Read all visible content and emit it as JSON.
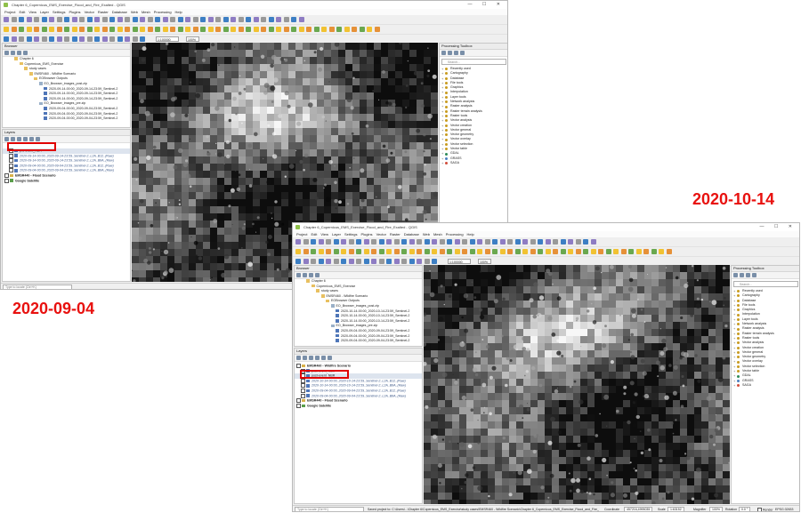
{
  "back_window": {
    "title": "Chapter 6_Copernicus_EMS_Exercise_Flood_and_Fire_Exalted - QGIS",
    "window_controls": "— ☐ ✕",
    "menu": [
      "Project",
      "Edit",
      "View",
      "Layer",
      "Settings",
      "Plugins",
      "Vector",
      "Raster",
      "Database",
      "Web",
      "Mesh",
      "Processing",
      "Help"
    ],
    "toolbar": {
      "scale_value": "1:100000",
      "zoom_value": "100%",
      "rotation_value": "0.0°",
      "render_value": "Render"
    },
    "browser": {
      "header": "Browser",
      "items": [
        {
          "label": "Chapter 6",
          "depth": 2,
          "kind": "folder"
        },
        {
          "label": "Copernicus_EMS_Exercise",
          "depth": 3,
          "kind": "folder"
        },
        {
          "label": "study cases",
          "depth": 4,
          "kind": "folder"
        },
        {
          "label": "EMSR460 - Wildfire Scenario",
          "depth": 5,
          "kind": "folder"
        },
        {
          "label": "EOBrowser Outputs",
          "depth": 6,
          "kind": "folder"
        },
        {
          "label": "EO_Browser_images_post.zip",
          "depth": 7,
          "kind": "zip"
        },
        {
          "label": "2020-09-14-00:00_2020-09-14-23:59_Sentinel-2",
          "depth": 8,
          "kind": "raster"
        },
        {
          "label": "2020-09-14-00:00_2020-09-14-23:59_Sentinel-2",
          "depth": 8,
          "kind": "raster"
        },
        {
          "label": "2020-09-14-00:00_2020-09-14-23:59_Sentinel-2",
          "depth": 8,
          "kind": "raster"
        },
        {
          "label": "EO_Browser_images_pre.zip",
          "depth": 7,
          "kind": "zip"
        },
        {
          "label": "2020-09-04-00:00_2020-09-04-23:59_Sentinel-2",
          "depth": 8,
          "kind": "raster"
        },
        {
          "label": "2020-09-04-00:00_2020-09-04-23:59_Sentinel-2",
          "depth": 8,
          "kind": "raster"
        },
        {
          "label": "2020-09-04-00:00_2020-09-04-23:59_Sentinel-2",
          "depth": 8,
          "kind": "raster"
        }
      ]
    },
    "layers": {
      "header": "Layers",
      "items": [
        {
          "label": "pre-event_NBR",
          "depth": 1,
          "kind": "raster",
          "highlight": true
        },
        {
          "label": "2020-09-14-00:00_2020-09-14-23:59_Sentinel-2_L2A_B12_(Raw)",
          "depth": 1,
          "kind": "raster",
          "muted": true
        },
        {
          "label": "2020-09-14-00:00_2020-09-14-23:59_Sentinel-2_L2A_B8A_(Raw)",
          "depth": 1,
          "kind": "raster",
          "muted": true
        },
        {
          "label": "2020-09-04-00:00_2020-09-04-23:59_Sentinel-2_L2A_B12_(Raw)",
          "depth": 1,
          "kind": "raster",
          "muted": true
        },
        {
          "label": "2020-09-04-00:00_2020-09-04-23:59_Sentinel-2_L2A_B8A_(Raw)",
          "depth": 1,
          "kind": "raster",
          "muted": true
        },
        {
          "label": "EMSR440 - Flood Scenario",
          "depth": 0,
          "kind": "group"
        },
        {
          "label": "Google Satellite",
          "depth": 0,
          "kind": "web"
        }
      ]
    },
    "processing": {
      "header": "Processing Toolbox",
      "search_placeholder": "Search...",
      "items": [
        "Recently used",
        "Cartography",
        "Database",
        "File tools",
        "Graphics",
        "Interpolation",
        "Layer tools",
        "Network analysis",
        "Raster analysis",
        "Raster terrain analysis",
        "Raster tools",
        "Vector analysis",
        "Vector creation",
        "Vector general",
        "Vector geometry",
        "Vector overlay",
        "Vector selection",
        "Vector table",
        "GDAL",
        "GRASS",
        "SAGA"
      ]
    },
    "status": {
      "locator_placeholder": "Type to locate (Ctrl+K)"
    }
  },
  "front_window": {
    "title": "Chapter 6_Copernicus_EMS_Exercise_Flood_and_Fire_Exalted - QGIS",
    "window_controls": "— ☐ ✕",
    "menu": [
      "Project",
      "Edit",
      "View",
      "Layer",
      "Settings",
      "Plugins",
      "Vector",
      "Raster",
      "Database",
      "Web",
      "Mesh",
      "Processing",
      "Help"
    ],
    "toolbar": {
      "scale_value": "1:100000",
      "zoom_value": "100%",
      "rotation_value": "0.0°",
      "render_value": "Render"
    },
    "browser": {
      "header": "Browser",
      "items": [
        {
          "label": "Chapter 6",
          "depth": 2,
          "kind": "folder"
        },
        {
          "label": "Copernicus_EMS_Exercise",
          "depth": 3,
          "kind": "folder"
        },
        {
          "label": "study cases",
          "depth": 4,
          "kind": "folder"
        },
        {
          "label": "EMSR460 - Wildfire Scenario",
          "depth": 5,
          "kind": "folder"
        },
        {
          "label": "EOBrowser Outputs",
          "depth": 6,
          "kind": "folder"
        },
        {
          "label": "EO_Browser_images_post.zip",
          "depth": 7,
          "kind": "zip"
        },
        {
          "label": "2020-10-14-00:00_2020-10-14-23:59_Sentinel-2",
          "depth": 8,
          "kind": "raster"
        },
        {
          "label": "2020-10-14-00:00_2020-10-14-23:59_Sentinel-2",
          "depth": 8,
          "kind": "raster"
        },
        {
          "label": "2020-10-14-00:00_2020-10-14-23:59_Sentinel-2",
          "depth": 8,
          "kind": "raster"
        },
        {
          "label": "EO_Browser_images_pre.zip",
          "depth": 7,
          "kind": "zip"
        },
        {
          "label": "2020-09-04-00:00_2020-09-04-23:59_Sentinel-2",
          "depth": 8,
          "kind": "raster"
        },
        {
          "label": "2020-09-04-00:00_2020-09-04-23:59_Sentinel-2",
          "depth": 8,
          "kind": "raster"
        },
        {
          "label": "2020-09-04-00:00_2020-09-04-23:59_Sentinel-2",
          "depth": 8,
          "kind": "raster"
        }
      ]
    },
    "layers": {
      "header": "Layers",
      "items": [
        {
          "label": "EMSR460 - Wildfire Scenario",
          "depth": 0,
          "kind": "group"
        },
        {
          "label": "post-event_NBR",
          "depth": 1,
          "kind": "raster"
        },
        {
          "label": "post-event_NBR",
          "depth": 1,
          "kind": "raster",
          "highlight": true
        },
        {
          "label": "2020-10-14-00:00_2020-10-14-23:59_Sentinel-2_L2A_B12_(Raw)",
          "depth": 1,
          "kind": "raster",
          "muted": true
        },
        {
          "label": "2020-10-14-00:00_2020-10-14-23:59_Sentinel-2_L2A_B8A_(Raw)",
          "depth": 1,
          "kind": "raster",
          "muted": true
        },
        {
          "label": "2020-09-04-00:00_2020-09-04-23:59_Sentinel-2_L2A_B12_(Raw)",
          "depth": 1,
          "kind": "raster",
          "muted": true
        },
        {
          "label": "2020-09-04-00:00_2020-09-04-23:59_Sentinel-2_L2A_B8A_(Raw)",
          "depth": 1,
          "kind": "raster",
          "muted": true
        },
        {
          "label": "EMSR440 - Flood Scenario",
          "depth": 0,
          "kind": "group"
        },
        {
          "label": "Google Satellite",
          "depth": 0,
          "kind": "web"
        }
      ]
    },
    "processing": {
      "header": "Processing Toolbox",
      "search_placeholder": "Search...",
      "items": [
        "Recently used",
        "Cartography",
        "Database",
        "File tools",
        "Graphics",
        "Interpolation",
        "Layer tools",
        "Network analysis",
        "Raster analysis",
        "Raster terrain analysis",
        "Raster tools",
        "Vector analysis",
        "Vector creation",
        "Vector general",
        "Vector geometry",
        "Vector overlay",
        "Vector selection",
        "Vector table",
        "GDAL",
        "GRASS",
        "SAGA"
      ]
    },
    "status": {
      "locator_placeholder": "Type to locate (Ctrl+K)",
      "message": "Saved project to: C:\\Users\\...\\Chapter 6\\Copernicus_EMS_Exercise\\study cases\\EMSR460 - Wildfire Scenario\\Chapter 6_Copernicus_EMS_Exercise_Flood_and_Fire_Exalted",
      "coordinate_label": "Coordinate",
      "coordinate_value": "457216,4995035",
      "scale_label": "Scale",
      "scale_value": "1:63152",
      "magnifier_label": "Magnifier",
      "magnifier_value": "100%",
      "rotation_label": "Rotation",
      "rotation_value": "0.0 °",
      "render_label": "Render",
      "crs_label": "EPSG:32633"
    }
  },
  "annotations": {
    "date_right": "2020-10-14",
    "date_left": "2020-09-04",
    "highlight_color": "#e00000",
    "date_color": "#e8110f"
  }
}
